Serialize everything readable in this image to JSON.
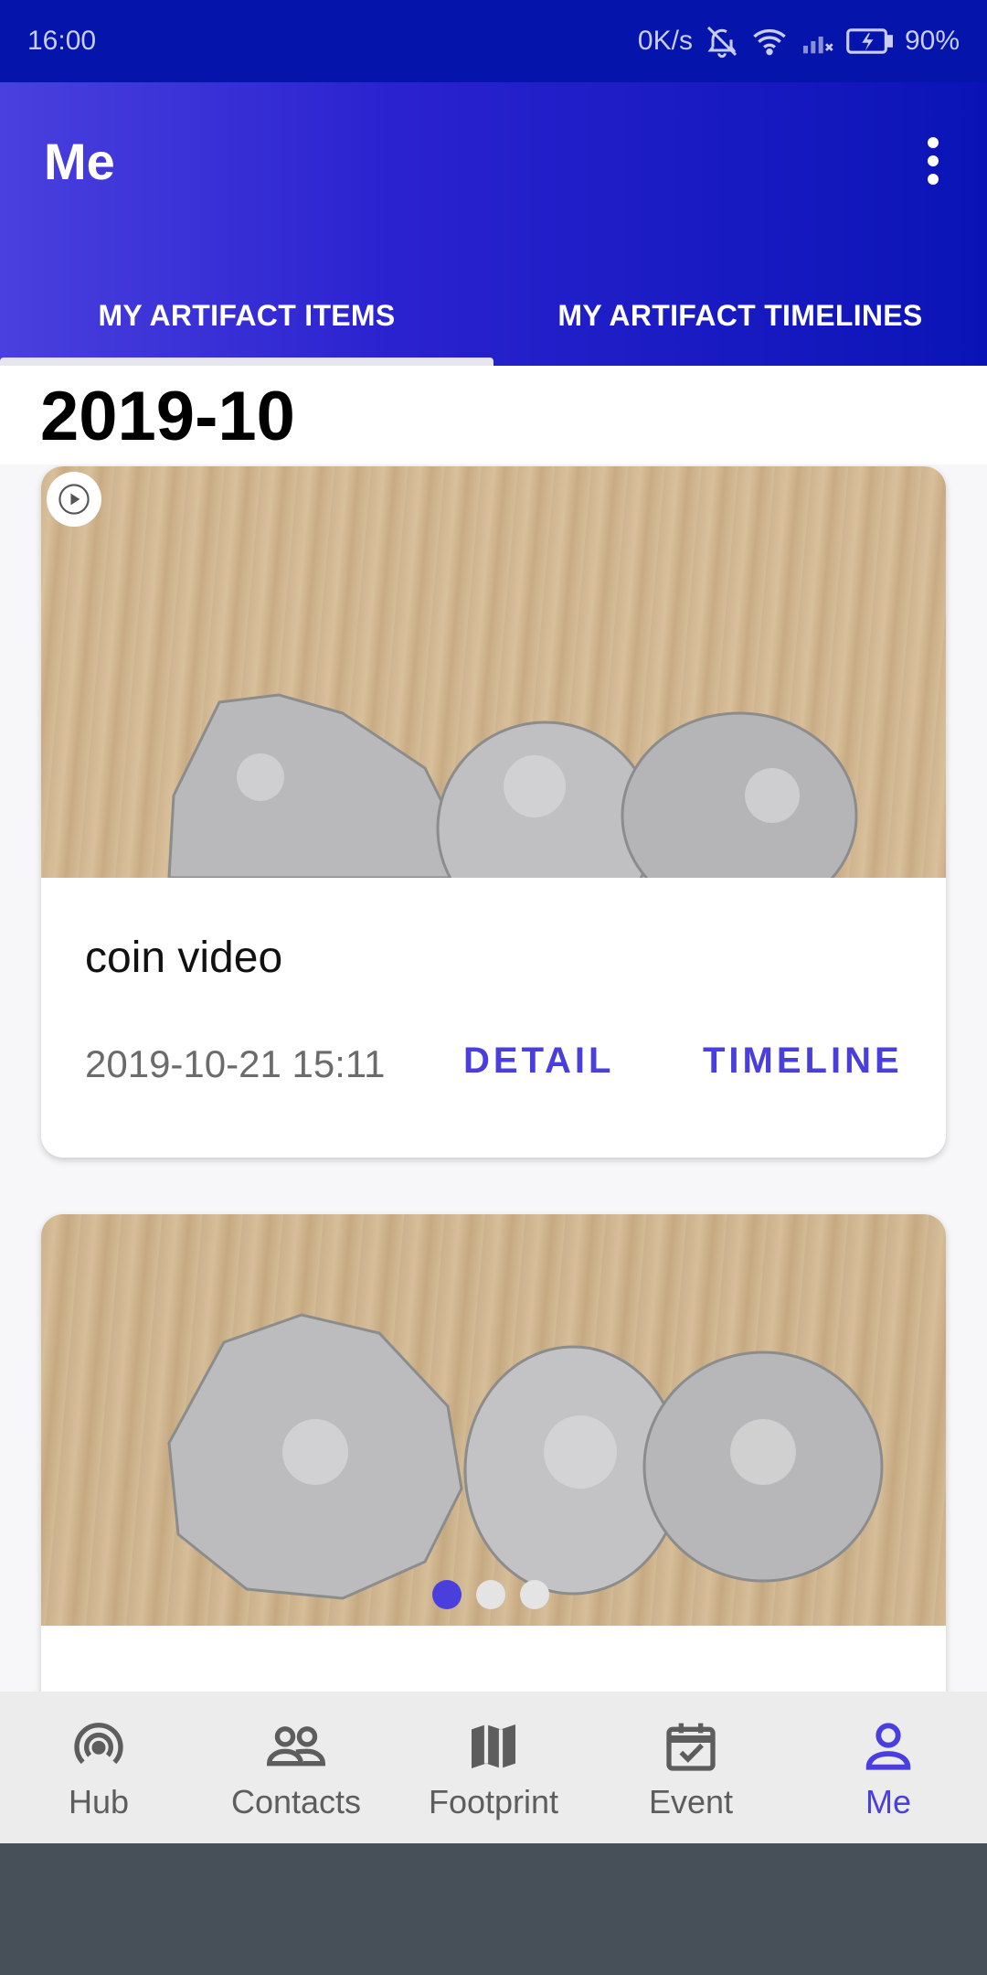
{
  "status_bar": {
    "time": "16:00",
    "net_speed": "0K/s",
    "battery": "90%"
  },
  "app_bar": {
    "title": "Me",
    "overflow_icon": "more-vertical-icon"
  },
  "tabs": [
    {
      "label": "MY ARTIFACT ITEMS",
      "active": true
    },
    {
      "label": "MY ARTIFACT TIMELINES",
      "active": false
    }
  ],
  "section": {
    "header": "2019-10"
  },
  "cards": [
    {
      "title": "coin video",
      "date": "2019-10-21 15:11",
      "detail_label": "DETAIL",
      "timeline_label": "TIMELINE",
      "media_type": "video"
    },
    {
      "media_type": "image-carousel",
      "carousel_pages": 3,
      "carousel_active": 1
    }
  ],
  "bottom_nav": {
    "items": [
      {
        "label": "Hub",
        "icon": "hub-icon"
      },
      {
        "label": "Contacts",
        "icon": "contacts-icon"
      },
      {
        "label": "Footprint",
        "icon": "map-icon"
      },
      {
        "label": "Event",
        "icon": "calendar-check-icon"
      },
      {
        "label": "Me",
        "icon": "person-icon",
        "active": true
      }
    ]
  },
  "colors": {
    "accent": "#4a3fdc",
    "app_bar_dark": "#0515ac",
    "app_bar_light": "#4a40de"
  }
}
